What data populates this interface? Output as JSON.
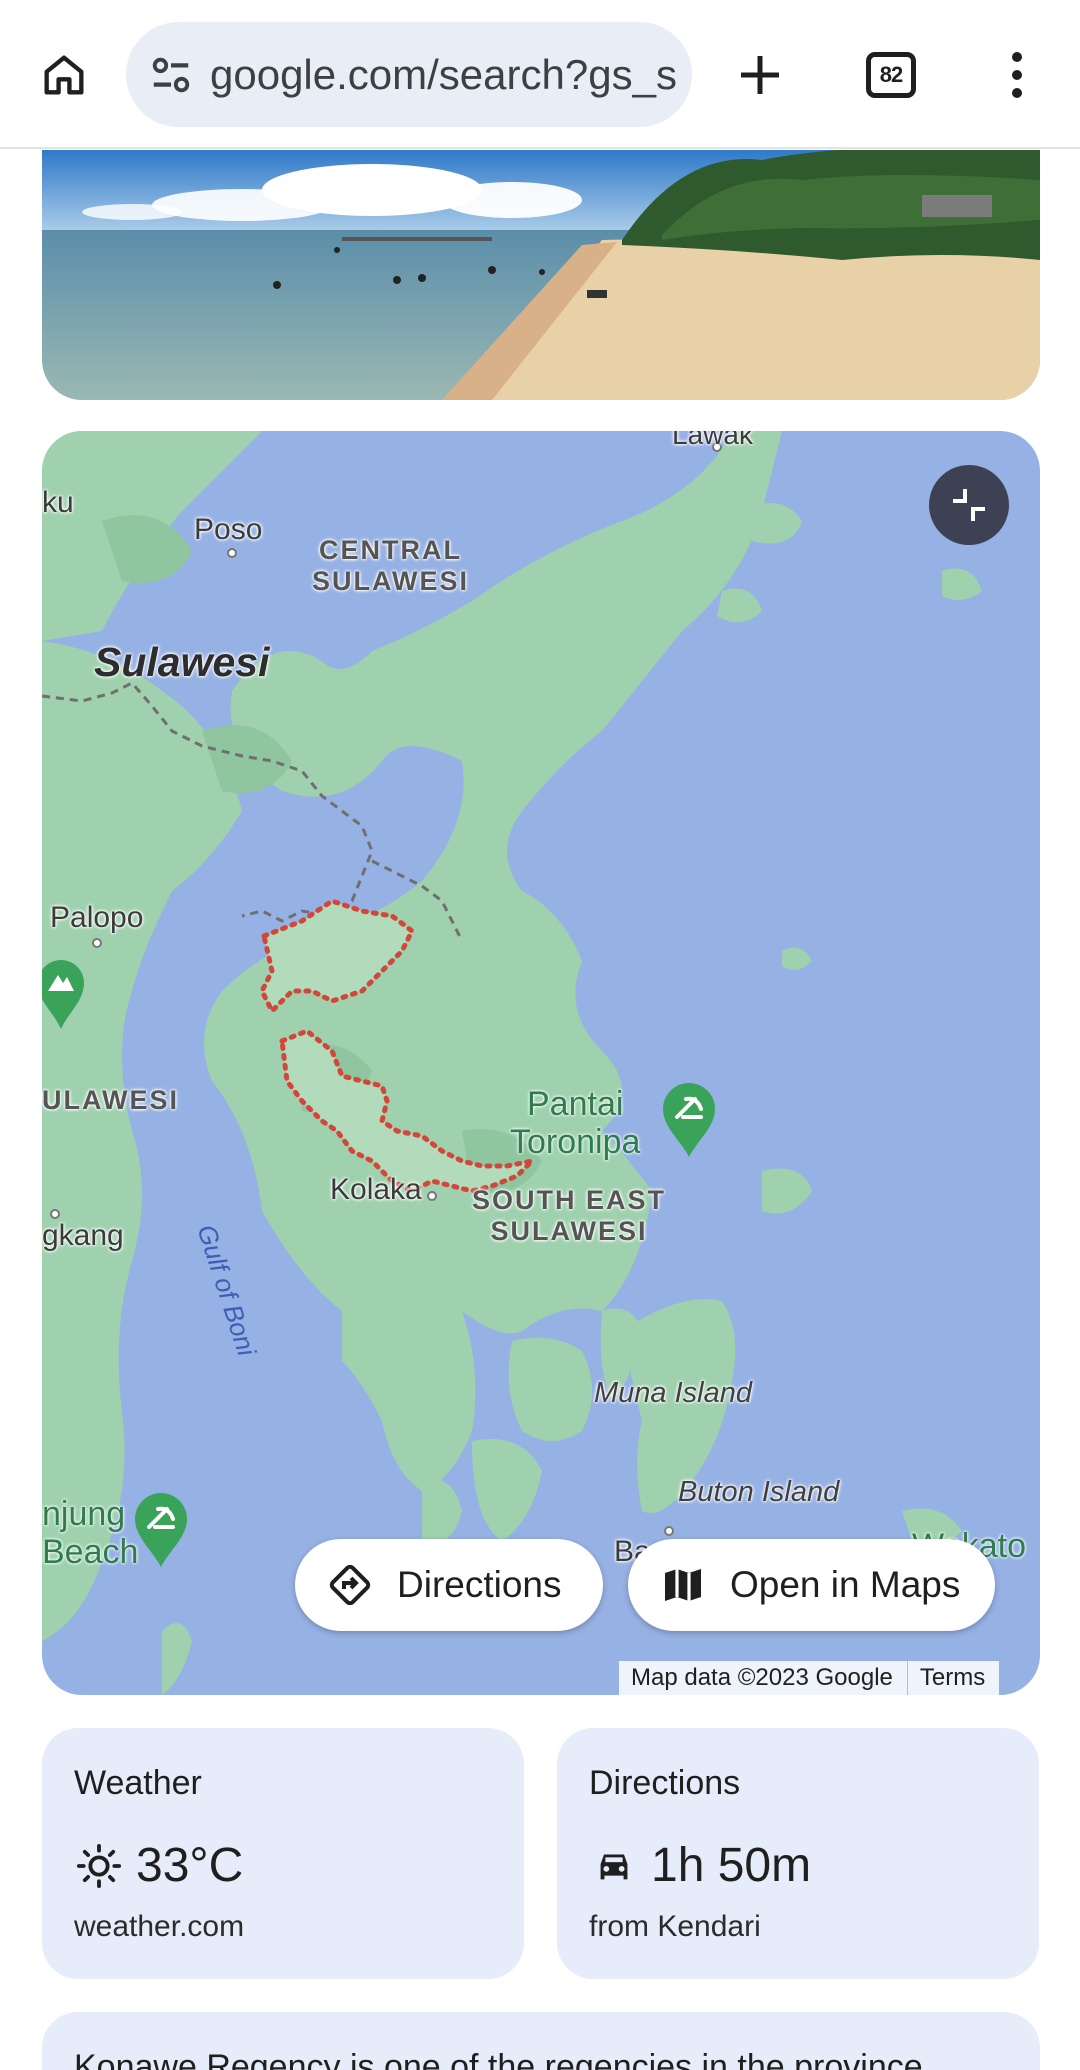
{
  "browser": {
    "url": "google.com/search?gs_s",
    "tab_count": "82",
    "icons": {
      "home": "home-icon",
      "site_info": "tune-icon",
      "new_tab": "plus-icon",
      "tabs": "tab-switcher-icon",
      "menu": "more-vert-icon"
    }
  },
  "photo": {
    "alt": "Pantai Toronipa beach"
  },
  "map": {
    "labels": {
      "lawak": "Lawak",
      "ku": "ku",
      "poso": "Poso",
      "central": "CENTRAL\nSULAWESI",
      "sulawesi": "Sulawesi",
      "palopo": "Palopo",
      "ulawesi": "ULAWESI",
      "gulf": "Gulf of Boni",
      "kolaka": "Kolaka",
      "gkang": "gkang",
      "pantai": "Pantai\nToronipa",
      "southeast": "SOUTH EAST\nSULAWESI",
      "muna": "Muna Island",
      "buton": "Buton Island",
      "tanjung": "njung\nBeach",
      "ba": "Ba",
      "wakatobi": "Wakato\nal P"
    },
    "buttons": {
      "directions": "Directions",
      "open_in_maps": "Open in Maps"
    },
    "attribution": "Map data ©2023 Google",
    "terms": "Terms",
    "colors": {
      "water": "#96b1e4",
      "land": "#9fd1ae",
      "boundary": "#d3473a",
      "button_dark": "#3c4154"
    }
  },
  "cards": {
    "weather": {
      "title": "Weather",
      "value": "33°C",
      "source": "weather.com",
      "icon": "sun-icon"
    },
    "directions": {
      "title": "Directions",
      "value": "1h 50m",
      "from": "from Kendari",
      "icon": "car-icon"
    }
  },
  "description": "Konawe Regency is one of the regencies in the province"
}
